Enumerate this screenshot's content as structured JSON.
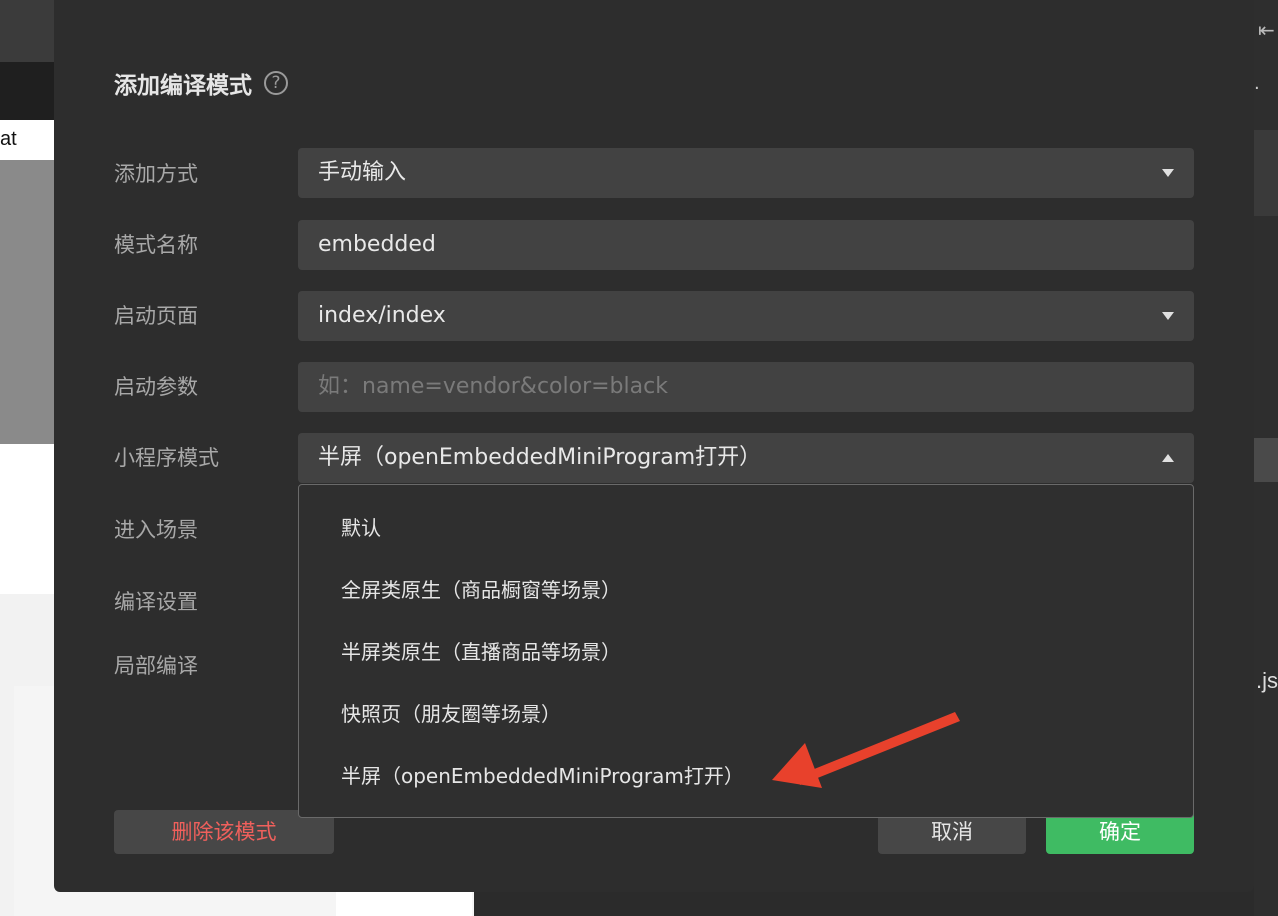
{
  "background": {
    "status_text": "at",
    "right_text": ".js"
  },
  "dialog": {
    "title": "添加编译模式",
    "help_icon": "?",
    "fields": {
      "add_method": {
        "label": "添加方式",
        "value": "手动输入"
      },
      "mode_name": {
        "label": "模式名称",
        "value": "embedded"
      },
      "start_page": {
        "label": "启动页面",
        "value": "index/index"
      },
      "start_params": {
        "label": "启动参数",
        "placeholder": "如：name=vendor&color=black"
      },
      "mini_mode": {
        "label": "小程序模式",
        "value": "半屏（openEmbeddedMiniProgram打开）"
      },
      "scene": {
        "label": "进入场景"
      },
      "compile_settings": {
        "label": "编译设置"
      },
      "partial_compile": {
        "label": "局部编译"
      }
    },
    "dropdown_options": [
      "默认",
      "全屏类原生（商品橱窗等场景）",
      "半屏类原生（直播商品等场景）",
      "快照页（朋友圈等场景）",
      "半屏（openEmbeddedMiniProgram打开）"
    ],
    "buttons": {
      "delete": "删除该模式",
      "cancel": "取消",
      "ok": "确定"
    }
  },
  "colors": {
    "accent_green": "#3fbb63",
    "danger_red": "#f0605c",
    "annotation_arrow": "#e8412c"
  }
}
